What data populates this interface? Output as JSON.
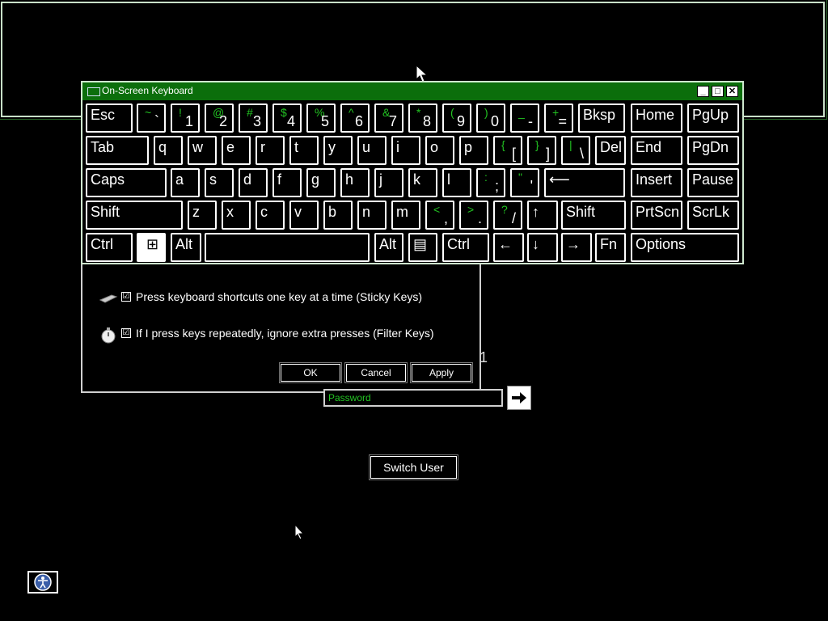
{
  "osk": {
    "title": "On-Screen Keyboard",
    "controls": {
      "minimize": "_",
      "maximize": "□",
      "close": "✕"
    },
    "rows": [
      [
        {
          "label": "Esc"
        },
        {
          "shift": "~",
          "base": "`"
        },
        {
          "shift": "!",
          "base": "1"
        },
        {
          "shift": "@",
          "base": "2"
        },
        {
          "shift": "#",
          "base": "3"
        },
        {
          "shift": "$",
          "base": "4"
        },
        {
          "shift": "%",
          "base": "5"
        },
        {
          "shift": "^",
          "base": "6"
        },
        {
          "shift": "&",
          "base": "7"
        },
        {
          "shift": "*",
          "base": "8"
        },
        {
          "shift": "(",
          "base": "9"
        },
        {
          "shift": ")",
          "base": "0"
        },
        {
          "shift": "_",
          "base": "-"
        },
        {
          "shift": "+",
          "base": "="
        },
        {
          "label": "Bksp"
        },
        {
          "label": "Home"
        },
        {
          "label": "PgUp"
        }
      ],
      [
        {
          "label": "Tab"
        },
        {
          "label": "q"
        },
        {
          "label": "w"
        },
        {
          "label": "e"
        },
        {
          "label": "r"
        },
        {
          "label": "t"
        },
        {
          "label": "y"
        },
        {
          "label": "u"
        },
        {
          "label": "i"
        },
        {
          "label": "o"
        },
        {
          "label": "p"
        },
        {
          "shift": "{",
          "base": "["
        },
        {
          "shift": "}",
          "base": "]"
        },
        {
          "shift": "|",
          "base": "\\"
        },
        {
          "label": "Del"
        },
        {
          "label": "End"
        },
        {
          "label": "PgDn"
        }
      ],
      [
        {
          "label": "Caps"
        },
        {
          "label": "a"
        },
        {
          "label": "s"
        },
        {
          "label": "d"
        },
        {
          "label": "f"
        },
        {
          "label": "g"
        },
        {
          "label": "h"
        },
        {
          "label": "j"
        },
        {
          "label": "k"
        },
        {
          "label": "l"
        },
        {
          "shift": ":",
          "base": ";"
        },
        {
          "shift": "\"",
          "base": "'"
        },
        {
          "label": "⟵"
        },
        {
          "label": "Insert"
        },
        {
          "label": "Pause"
        }
      ],
      [
        {
          "label": "Shift"
        },
        {
          "label": "z"
        },
        {
          "label": "x"
        },
        {
          "label": "c"
        },
        {
          "label": "v"
        },
        {
          "label": "b"
        },
        {
          "label": "n"
        },
        {
          "label": "m"
        },
        {
          "shift": "<",
          "base": ","
        },
        {
          "shift": ">",
          "base": "."
        },
        {
          "shift": "?",
          "base": "/"
        },
        {
          "label": "↑"
        },
        {
          "label": "Shift"
        },
        {
          "label": "PrtScn"
        },
        {
          "label": "ScrLk"
        }
      ],
      [
        {
          "label": "Ctrl"
        },
        {
          "label": "⊞"
        },
        {
          "label": "Alt"
        },
        {
          "label": ""
        },
        {
          "label": "Alt"
        },
        {
          "label": "▤"
        },
        {
          "label": "Ctrl"
        },
        {
          "label": "←"
        },
        {
          "label": "↓"
        },
        {
          "label": "→"
        },
        {
          "label": "Fn"
        },
        {
          "label": "Options"
        }
      ]
    ]
  },
  "dialog": {
    "option1": "Press keyboard shortcuts one key at a time (Sticky Keys)",
    "option2": "If I press keys repeatedly, ignore extra presses (Filter Keys)",
    "check": "☑",
    "ok": "OK",
    "cancel": "Cancel",
    "apply": "Apply"
  },
  "partial_text": "1",
  "login": {
    "password_placeholder": "Password",
    "switch_user": "Switch User"
  },
  "colors": {
    "accent_green": "#22c322",
    "title_green": "#0b6e0b"
  }
}
